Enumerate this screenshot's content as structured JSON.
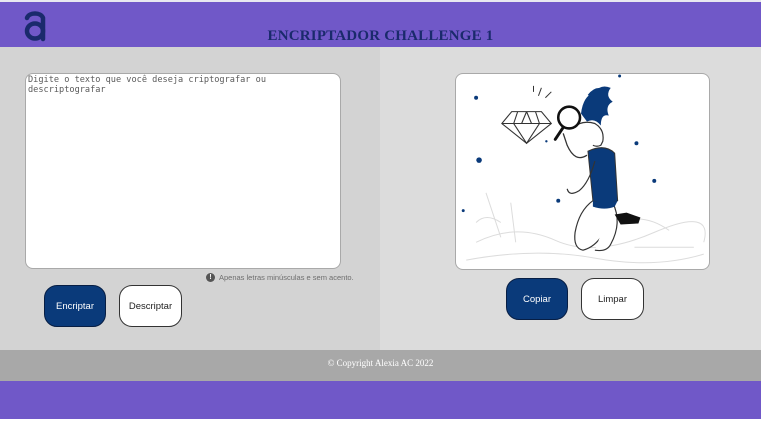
{
  "header": {
    "logo_glyph": "a",
    "title": "ENCRIPTADOR CHALLENGE 1",
    "background_color": "#7058c8",
    "title_color": "#1a2a6c"
  },
  "input": {
    "placeholder": "Digite o texto que você deseja criptografar ou descriptografar",
    "value": ""
  },
  "hint": {
    "icon": "info-icon",
    "icon_glyph": "!",
    "text": "Apenas letras minúsculas e sem acento."
  },
  "actions_left": {
    "encrypt_label": "Encriptar",
    "decrypt_label": "Descriptar"
  },
  "output": {
    "illustration": "person-with-magnifying-glass-and-diamond"
  },
  "actions_right": {
    "copy_label": "Copiar",
    "clear_label": "Limpar"
  },
  "footer": {
    "copyright": "© Copyright Alexia AC 2022"
  },
  "colors": {
    "accent_dark": "#0a3a7a",
    "footer_gray": "#a8a8a8",
    "panel_left": "#d3d3d3",
    "panel_right": "#dcdcdc"
  }
}
